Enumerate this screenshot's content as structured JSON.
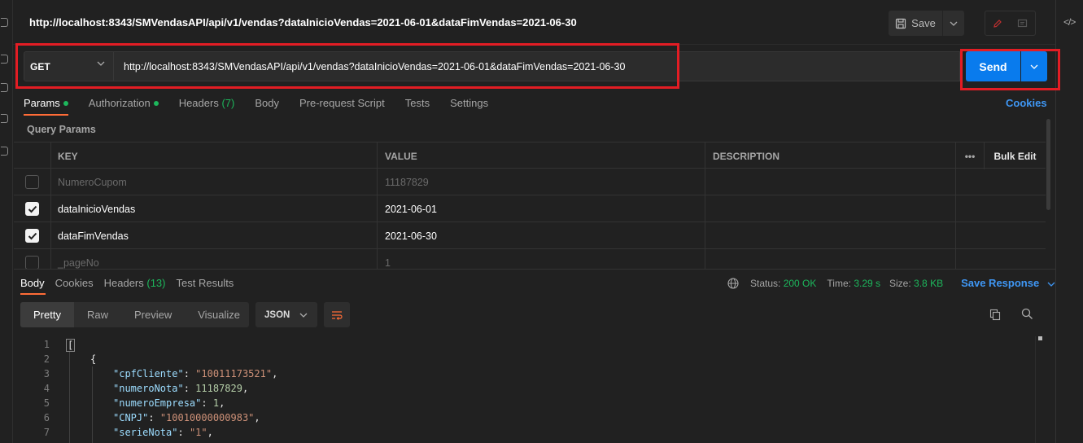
{
  "tab_title": "http://localhost:8343/SMVendasAPI/api/v1/vendas?dataInicioVendas=2021-06-01&dataFimVendas=2021-06-30",
  "toolbar": {
    "save_label": "Save"
  },
  "request": {
    "method": "GET",
    "url": "http://localhost:8343/SMVendasAPI/api/v1/vendas?dataInicioVendas=2021-06-01&dataFimVendas=2021-06-30",
    "send_label": "Send"
  },
  "request_tabs": {
    "params": "Params",
    "authorization": "Authorization",
    "headers": "Headers",
    "headers_count": "(7)",
    "body": "Body",
    "prerequest": "Pre-request Script",
    "tests": "Tests",
    "settings": "Settings",
    "cookies": "Cookies"
  },
  "query_params": {
    "label": "Query Params",
    "columns": {
      "key": "KEY",
      "value": "VALUE",
      "description": "DESCRIPTION",
      "more": "•••",
      "bulk_edit": "Bulk Edit"
    },
    "rows": [
      {
        "checked": false,
        "key": "NumeroCupom",
        "value": "11187829",
        "description": ""
      },
      {
        "checked": true,
        "key": "dataInicioVendas",
        "value": "2021-06-01",
        "description": ""
      },
      {
        "checked": true,
        "key": "dataFimVendas",
        "value": "2021-06-30",
        "description": ""
      },
      {
        "checked": false,
        "key": "_pageNo",
        "value": "1",
        "description": ""
      }
    ]
  },
  "response_tabs": {
    "body": "Body",
    "cookies": "Cookies",
    "headers": "Headers",
    "headers_count": "(13)",
    "test_results": "Test Results"
  },
  "response_status": {
    "status_label": "Status:",
    "status_value": "200 OK",
    "time_label": "Time:",
    "time_value": "3.29 s",
    "size_label": "Size:",
    "size_value": "3.8 KB",
    "save_response": "Save Response"
  },
  "view_tabs": {
    "pretty": "Pretty",
    "raw": "Raw",
    "preview": "Preview",
    "visualize": "Visualize"
  },
  "format": "JSON",
  "code": {
    "line_numbers": [
      "1",
      "2",
      "3",
      "4",
      "5",
      "6",
      "7"
    ],
    "l1": "[",
    "l2": "{",
    "l3_key": "\"cpfCliente\"",
    "l3_val": "\"10011173521\"",
    "l4_key": "\"numeroNota\"",
    "l4_val": "11187829",
    "l5_key": "\"numeroEmpresa\"",
    "l5_val": "1",
    "l6_key": "\"CNPJ\"",
    "l6_val": "\"10010000000983\"",
    "l7_key": "\"serieNota\"",
    "l7_val": "\"1\""
  },
  "colors": {
    "accent_orange": "#ff6c37",
    "send_blue": "#097bed",
    "link_blue": "#3f97f5",
    "success_green": "#1db75c",
    "highlight_red": "#e31d24"
  }
}
